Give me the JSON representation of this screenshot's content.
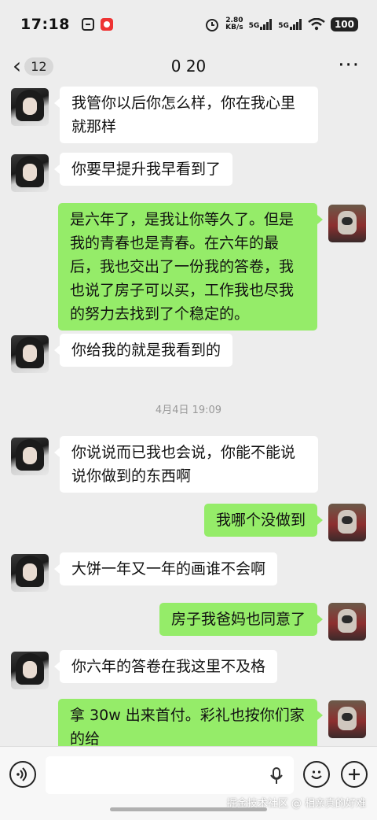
{
  "status_bar": {
    "time": "17:18",
    "net_speed_value": "2.80",
    "net_speed_unit": "KB/s",
    "signal1": "5G",
    "signal2": "5G",
    "battery": "100"
  },
  "nav": {
    "unread_count": "12",
    "title": "0 20",
    "more_icon": "more-dots-icon"
  },
  "messages": [
    {
      "from": "her",
      "text": "我管你以后你怎么样，你在我心里就那样"
    },
    {
      "from": "her",
      "text": "你要早提升我早看到了"
    },
    {
      "from": "me",
      "text": "是六年了，是我让你等久了。但是我的青春也是青春。在六年的最后，我也交出了一份我的答卷，我也说了房子可以买，工作我也尽我的努力去找到了个稳定的。"
    },
    {
      "from": "her",
      "text": "你给我的就是我看到的"
    },
    {
      "from": "her",
      "text": "你说说而已我也会说，你能不能说说你做到的东西啊"
    },
    {
      "from": "me",
      "text": "我哪个没做到"
    },
    {
      "from": "her",
      "text": "大饼一年又一年的画谁不会啊"
    },
    {
      "from": "me",
      "text": "房子我爸妈也同意了"
    },
    {
      "from": "her",
      "text": "你六年的答卷在我这里不及格"
    },
    {
      "from": "me",
      "text": "拿 30w 出来首付。彩礼也按你们家的给"
    }
  ],
  "timestamp": "4月4日 19:09",
  "input": {
    "voice_icon": "voice-icon",
    "mic_icon": "mic-icon",
    "emoji_icon": "emoji-icon",
    "plus_icon": "plus-icon"
  },
  "watermark": "掘金技术社区 @ 相亲真的好难"
}
